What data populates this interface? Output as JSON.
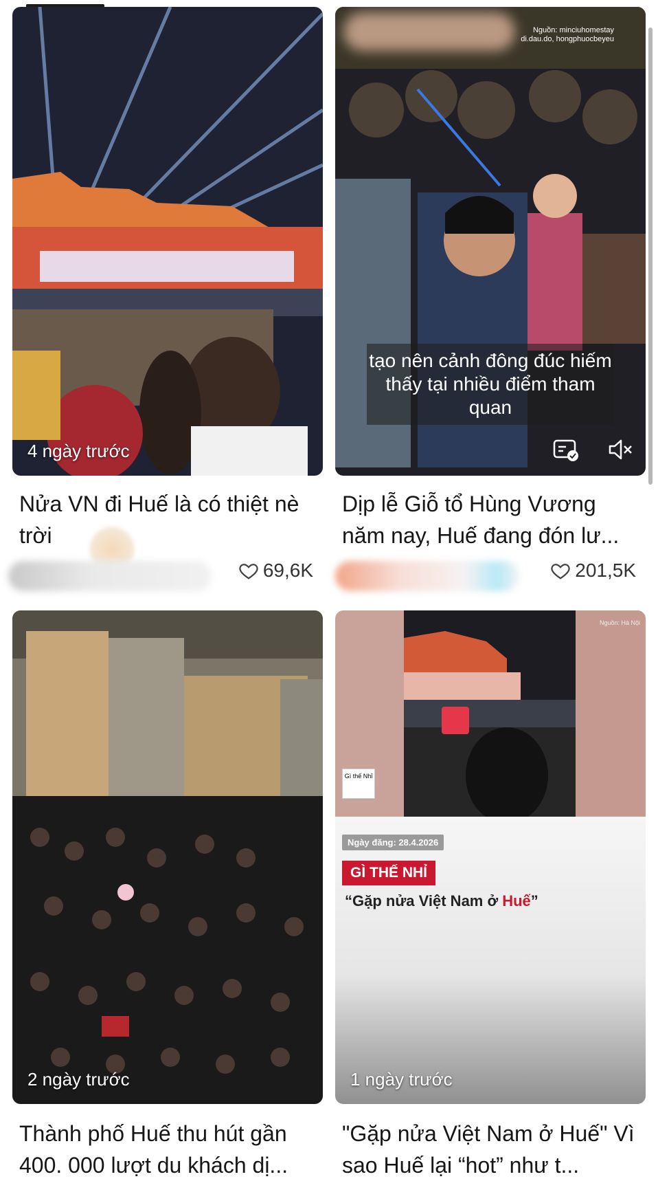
{
  "cards": [
    {
      "age": "4 ngày trước",
      "title": "Nửa VN đi Huế là có thiệt nè trời",
      "likes": "69,6K"
    },
    {
      "age": "",
      "title": "Dịp lễ Giỗ tổ Hùng Vương năm nay, Huế đang đón lư...",
      "likes": "201,5K",
      "caption": "tạo nên cảnh đông đúc hiếm thấy tại nhiều điểm tham quan",
      "source": "Nguồn: minciuhomestay\ndi.dau.do, hongphuocbeyeu"
    },
    {
      "age": "2 ngày trước",
      "title": "Thành phố Huế thu hút gần 400. 000 lượt du khách dị..."
    },
    {
      "age": "1 ngày trước",
      "title": "\"Gặp nửa Việt Nam ở Huế\" Vì sao Huế lại “hot” như t...",
      "date_tag": "Ngày đăng: 28.4.2026",
      "brand_tag": "GÌ THẾ NHỈ",
      "quote_a": "“Gặp nửa Việt Nam ở ",
      "quote_b": "Huế",
      "quote_c": "”",
      "source": "Nguồn: Hà Nội",
      "logo": "Gì thế Nhỉ"
    }
  ],
  "colors": {
    "accent_red": "#c9182f",
    "text": "#161616"
  },
  "icons": [
    "heart-icon",
    "captions-icon",
    "mute-icon"
  ]
}
